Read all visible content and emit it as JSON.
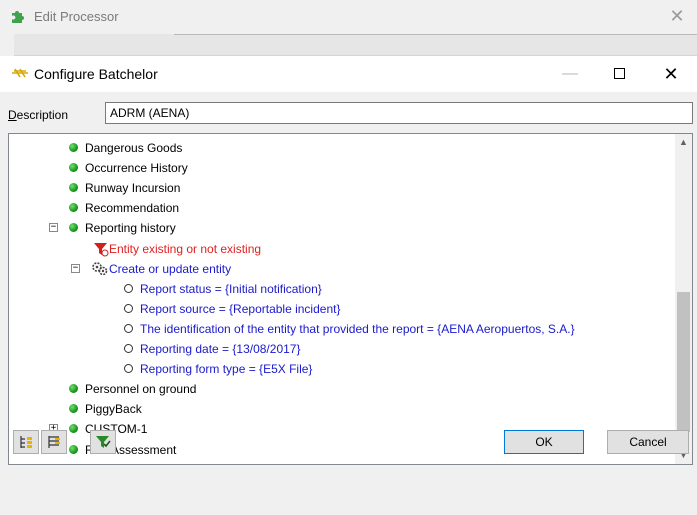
{
  "parent_window": {
    "title": "Edit Processor",
    "close_glyph": "✕",
    "icon": "puzzle-icon"
  },
  "dialog": {
    "title": "Configure Batchelor",
    "icon": "batchelor-icon",
    "minimize_glyph": "—",
    "close_glyph": "✕"
  },
  "description": {
    "label": "Description",
    "value": "ADRM (AENA)"
  },
  "tree": {
    "items": [
      {
        "label": "Dangerous Goods",
        "type": "node"
      },
      {
        "label": "Occurrence History",
        "type": "node"
      },
      {
        "label": "Runway Incursion",
        "type": "node"
      },
      {
        "label": "Recommendation",
        "type": "node"
      },
      {
        "label": "Reporting history",
        "type": "node",
        "expander": "−"
      },
      {
        "label": "Entity existing or not existing",
        "type": "condition"
      },
      {
        "label": "Create or update entity",
        "type": "action",
        "expander": "−"
      },
      {
        "label": "Report status = {Initial notification}",
        "type": "field"
      },
      {
        "label": "Report source = {Reportable incident}",
        "type": "field"
      },
      {
        "label": "The identification of the entity that provided the report = {AENA Aeropuertos, S.A.}",
        "type": "field"
      },
      {
        "label": "Reporting date = {13/08/2017}",
        "type": "field"
      },
      {
        "label": "Reporting form type = {E5X File}",
        "type": "field"
      },
      {
        "label": "Personnel on ground",
        "type": "node"
      },
      {
        "label": "PiggyBack",
        "type": "node"
      },
      {
        "label": "CUSTOM-1",
        "type": "node",
        "expander": "+"
      },
      {
        "label": "Risk Assessment",
        "type": "node"
      }
    ]
  },
  "buttons": {
    "ok": "OK",
    "cancel": "Cancel"
  },
  "colors": {
    "node_dot": "#1a9a1a",
    "condition_text": "#e02020",
    "action_text": "#1a1acc",
    "default_button_border": "#0078d7"
  }
}
